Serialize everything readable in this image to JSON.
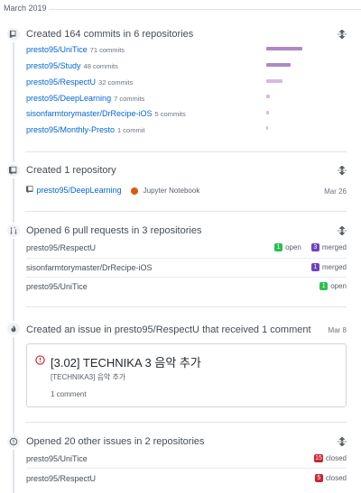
{
  "month": "March 2019",
  "commits": {
    "title": "Created 164 commits in 6 repositories",
    "repos": [
      {
        "name": "presto95/UniTice",
        "count": "71 commits",
        "share": 1.0
      },
      {
        "name": "presto95/Study",
        "count": "48 commits",
        "share": 0.68
      },
      {
        "name": "presto95/RespectU",
        "count": "32 commits",
        "share": 0.45
      },
      {
        "name": "presto95/DeepLearning",
        "count": "7 commits",
        "share": 0.1
      },
      {
        "name": "sisonfarmtorymaster/DrRecipe-iOS",
        "count": "5 commits",
        "share": 0.07
      },
      {
        "name": "presto95/Monthly-Presto",
        "count": "1 commit",
        "share": 0.02
      }
    ]
  },
  "created_repo": {
    "title": "Created 1 repository",
    "repo": "presto95/DeepLearning",
    "language": "Jupyter Notebook",
    "date": "Mar 26"
  },
  "pull_requests": {
    "title": "Opened 6 pull requests in 3 repositories",
    "repos": [
      {
        "name": "presto95/RespectU",
        "open_count": "1",
        "open_label": "open",
        "merged_count": "3",
        "merged_label": "merged"
      },
      {
        "name": "sisonfarmtorymaster/DrRecipe-iOS",
        "merged_count": "1",
        "merged_label": "merged"
      },
      {
        "name": "presto95/UniTice",
        "open_count": "1",
        "open_label": "open"
      }
    ]
  },
  "issue": {
    "title_prefix": "Created an issue in ",
    "title_repo": "presto95/RespectU",
    "title_suffix": " that received 1 comment",
    "date": "Mar 8",
    "issue_title": "[3.02] TECHNIKA 3 음악 추가",
    "issue_body": "[TECHNIKA3] 음악 추가",
    "comments": "1 comment"
  },
  "other_issues": {
    "title": "Opened 20 other issues in 2 repositories",
    "repos": [
      {
        "name": "presto95/UniTice",
        "closed_count": "15",
        "closed_label": "closed"
      },
      {
        "name": "presto95/RespectU",
        "closed_count": "5",
        "closed_label": "closed"
      }
    ]
  },
  "colors": {
    "link": "#0366d6",
    "bar_1": "#b087c4",
    "bar_2": "#d7b9e2",
    "open": "#2cbe4e",
    "merged": "#6f42c1",
    "closed": "#cb2431",
    "jupyter": "#DA5B0B"
  },
  "icons": [
    "repo-push-icon",
    "repo-icon",
    "pull-request-icon",
    "flame-icon",
    "issue-opened-icon",
    "unfold-icon"
  ]
}
